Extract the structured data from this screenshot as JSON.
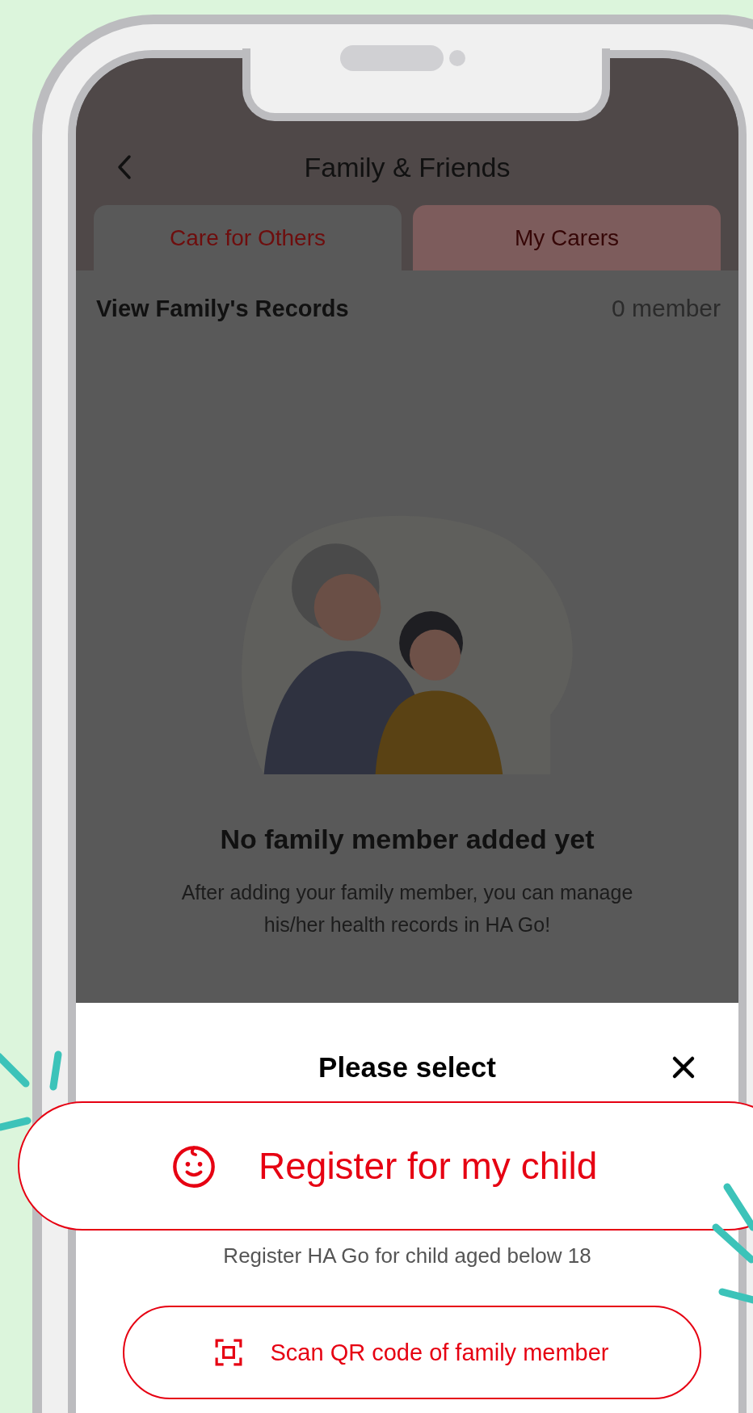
{
  "header": {
    "title": "Family & Friends"
  },
  "tabs": [
    {
      "label": "Care for Others",
      "selected": true
    },
    {
      "label": "My Carers",
      "selected": false
    }
  ],
  "records": {
    "title": "View Family's Records",
    "count": "0 member"
  },
  "empty_state": {
    "title": "No family member added yet",
    "message": "After adding your family member, you can manage his/her health records in HA Go!"
  },
  "sheet": {
    "title": "Please select",
    "register_button": "Register for my child",
    "register_note": "Register HA Go for child aged below 18",
    "scan_button": "Scan QR code of family member"
  }
}
